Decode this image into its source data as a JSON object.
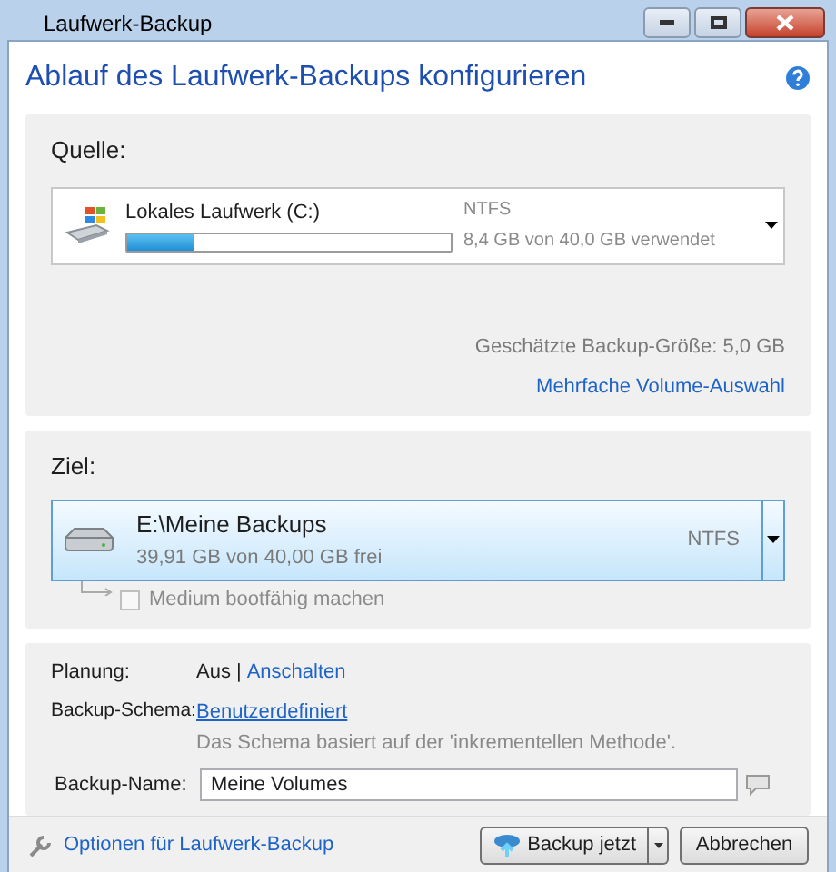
{
  "window": {
    "title": "Laufwerk-Backup"
  },
  "heading": "Ablauf des Laufwerk-Backups konfigurieren",
  "source": {
    "label": "Quelle:",
    "drive": {
      "name": "Lokales Laufwerk (C:)",
      "filesystem": "NTFS",
      "usage": "8,4 GB von 40,0 GB verwendet",
      "level": 0.21
    },
    "estimate": "Geschätzte Backup-Größe: 5,0 GB",
    "link": "Mehrfache Volume-Auswahl"
  },
  "destination": {
    "label": "Ziel:",
    "drive": {
      "name": "E:\\Meine Backups",
      "free": "39,91 GB von 40,00 GB frei",
      "filesystem": "NTFS",
      "selected": true
    },
    "bootable": {
      "label": "Medium bootfähig machen",
      "checked": false,
      "disabled": true
    }
  },
  "settings": {
    "schedule": {
      "label": "Planung:",
      "value": "Aus",
      "separator": "|",
      "link": "Anschalten"
    },
    "scheme": {
      "label": "Backup-Schema:",
      "link": "Benutzerdefiniert",
      "note": "Das Schema basiert auf der 'inkrementellen Methode'."
    },
    "name": {
      "label": "Backup-Name:",
      "value": "Meine Volumes"
    }
  },
  "footer": {
    "options_link": "Optionen für Laufwerk-Backup",
    "backup_button": "Backup jetzt",
    "cancel_button": "Abbrechen"
  }
}
